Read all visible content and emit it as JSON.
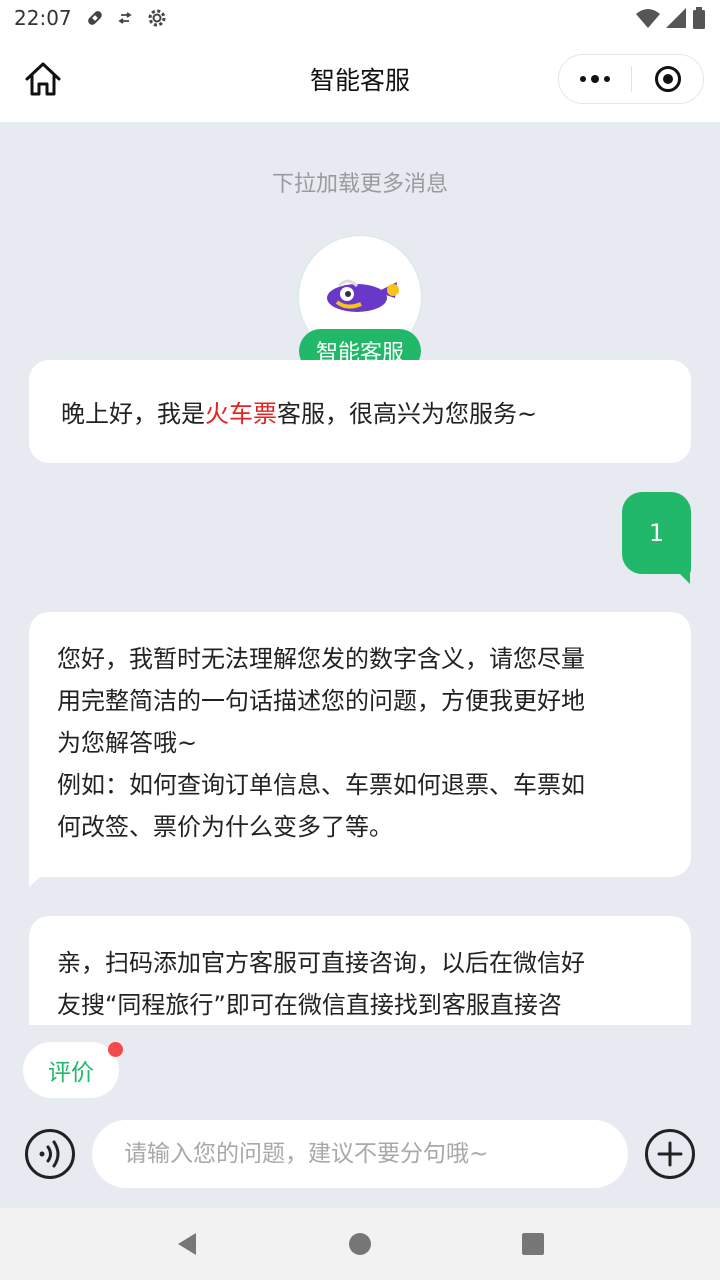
{
  "status_bar": {
    "time": "22:07"
  },
  "header": {
    "title": "智能客服"
  },
  "chat": {
    "load_more": "下拉加载更多消息",
    "bot_badge": "智能客服",
    "greeting": {
      "prefix": "晚上好，我是",
      "highlight": "火车票",
      "suffix": "客服，很高兴为您服务~"
    },
    "user_message": "1",
    "reply_lines": [
      "您好，我暂时无法理解您发的数字含义，请您尽量",
      "用完整简洁的一句话描述您的问题，方便我更好地",
      "为您解答哦~",
      "例如：如何查询订单信息、车票如何退票、车票如",
      "何改签、票价为什么变多了等。"
    ],
    "partial_lines": [
      "亲，扫码添加官方客服可直接咨询，以后在微信好",
      "友搜“同程旅行”即可在微信直接找到客服直接咨"
    ]
  },
  "bottom": {
    "rate_label": "评价",
    "input_placeholder": "请输入您的问题，建议不要分句哦~",
    "input_value": ""
  },
  "colors": {
    "accent": "#22b86a",
    "highlight": "#e52222",
    "background": "#e7eaf1",
    "badge_dot": "#f24b4b"
  },
  "icons": [
    "home-icon",
    "more-icon",
    "target-icon",
    "voice-icon",
    "plus-icon",
    "back-icon",
    "home-circle-icon",
    "recents-icon",
    "wifi-icon",
    "signal-icon",
    "battery-icon",
    "settings-icon"
  ]
}
